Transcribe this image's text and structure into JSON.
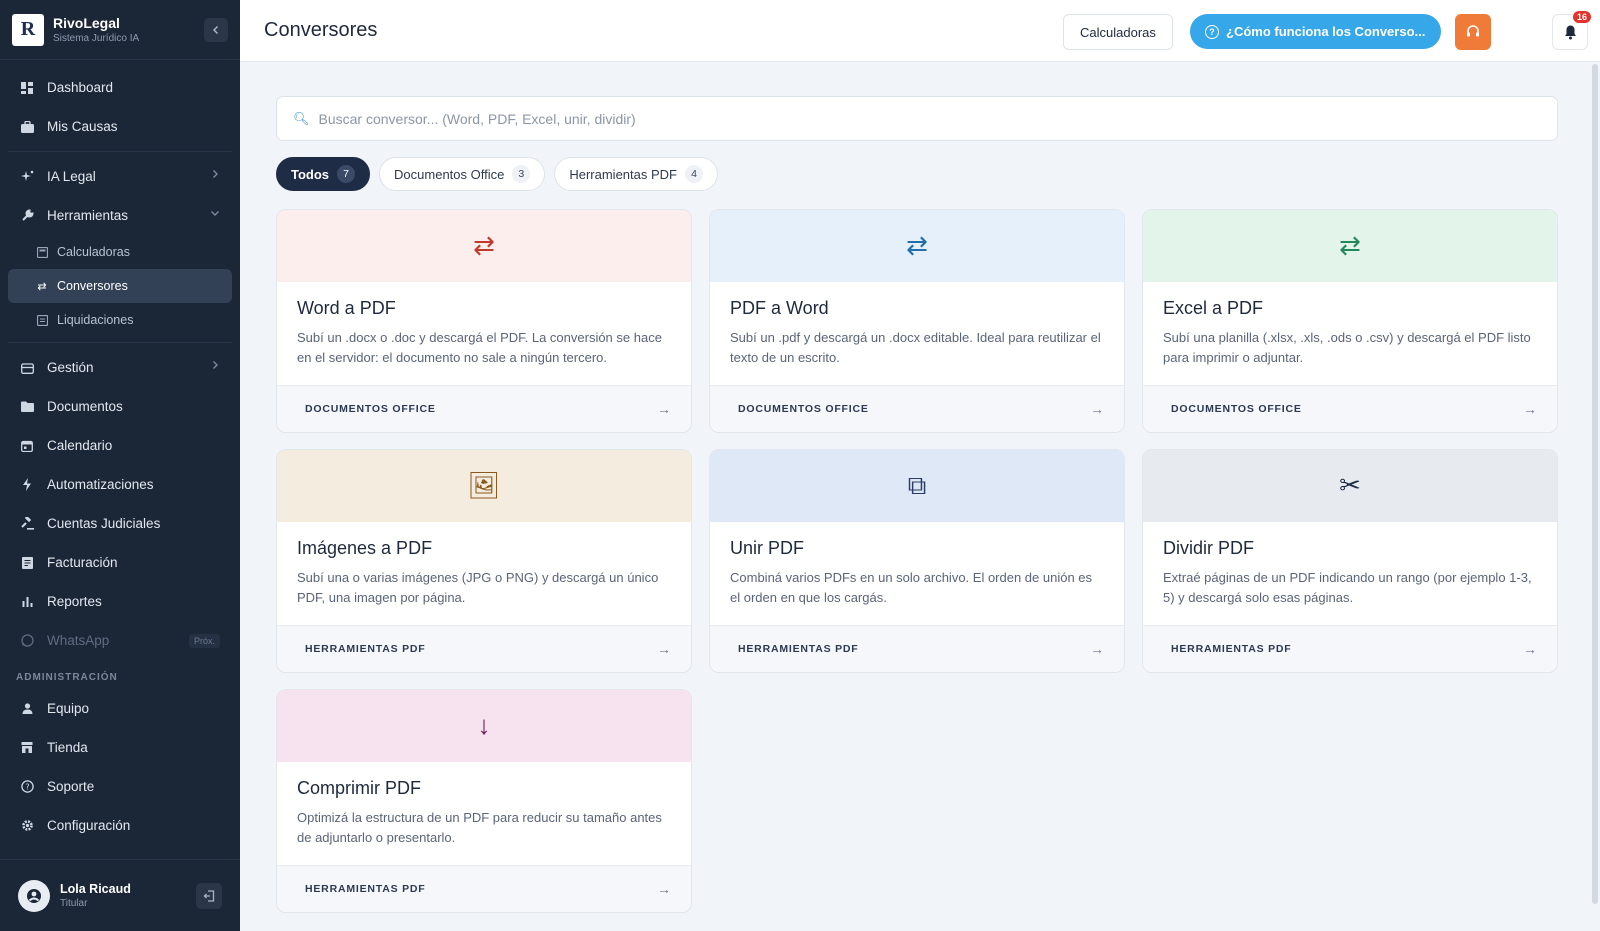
{
  "brand": {
    "name": "RivoLegal",
    "subtitle": "Sistema Jurídico IA",
    "logo_text": "R"
  },
  "sidebar": {
    "items": [
      {
        "label": "Dashboard",
        "icon": "dashboard-icon"
      },
      {
        "label": "Mis Causas",
        "icon": "briefcase-icon"
      },
      {
        "label": "IA Legal",
        "icon": "sparkle-icon"
      },
      {
        "label": "Herramientas",
        "icon": "wrench-icon"
      },
      {
        "label": "Gestión",
        "icon": "calendar-box-icon"
      },
      {
        "label": "Documentos",
        "icon": "folder-icon"
      },
      {
        "label": "Calendario",
        "icon": "calendar-icon"
      },
      {
        "label": "Automatizaciones",
        "icon": "bolt-icon"
      },
      {
        "label": "Cuentas Judiciales",
        "icon": "gavel-icon"
      },
      {
        "label": "Facturación",
        "icon": "invoice-icon"
      },
      {
        "label": "Reportes",
        "icon": "bar-chart-icon"
      },
      {
        "label": "WhatsApp",
        "icon": "whatsapp-icon",
        "badge": "Próx."
      }
    ],
    "subitems": [
      {
        "label": "Calculadoras"
      },
      {
        "label": "Conversores"
      },
      {
        "label": "Liquidaciones"
      }
    ],
    "admin_label": "ADMINISTRACIÓN",
    "admin_items": [
      {
        "label": "Equipo",
        "icon": "person-icon"
      },
      {
        "label": "Tienda",
        "icon": "store-icon"
      },
      {
        "label": "Soporte",
        "icon": "help-icon"
      },
      {
        "label": "Configuración",
        "icon": "gear-icon"
      }
    ]
  },
  "user": {
    "name": "Lola Ricaud",
    "role": "Titular"
  },
  "header": {
    "title": "Conversores",
    "calc_button": "Calculadoras",
    "help_button": "¿Cómo funciona los Converso...",
    "notifications": "16"
  },
  "search": {
    "placeholder": "Buscar conversor... (Word, PDF, Excel, unir, dividir)",
    "value": ""
  },
  "filters": [
    {
      "label": "Todos",
      "count": "7",
      "active": true
    },
    {
      "label": "Documentos Office",
      "count": "3",
      "active": false
    },
    {
      "label": "Herramientas PDF",
      "count": "4",
      "active": false
    }
  ],
  "cards": [
    {
      "title": "Word a PDF",
      "desc": "Subí un .docx o .doc y descargá el PDF. La conversión se hace en el servidor: el documento no sale a ningún tercero.",
      "category": "DOCUMENTOS OFFICE",
      "icon": "swap-icon",
      "glyph": "⇄",
      "bg": "#fbeeed",
      "color": "#c0392b"
    },
    {
      "title": "PDF a Word",
      "desc": "Subí un .pdf y descargá un .docx editable. Ideal para reutilizar el texto de un escrito.",
      "category": "DOCUMENTOS OFFICE",
      "icon": "swap-icon",
      "glyph": "⇄",
      "bg": "#e5f0fb",
      "color": "#1f6fa8"
    },
    {
      "title": "Excel a PDF",
      "desc": "Subí una planilla (.xlsx, .xls, .ods o .csv) y descargá el PDF listo para imprimir o adjuntar.",
      "category": "DOCUMENTOS OFFICE",
      "icon": "swap-icon",
      "glyph": "⇄",
      "bg": "#e3f5ea",
      "color": "#23895a"
    },
    {
      "title": "Imágenes a PDF",
      "desc": "Subí una o varias imágenes (JPG o PNG) y descargá un único PDF, una imagen por página.",
      "category": "HERRAMIENTAS PDF",
      "icon": "images-icon",
      "glyph": "🖼",
      "bg": "#f5ece0",
      "color": "#8a5a1c"
    },
    {
      "title": "Unir PDF",
      "desc": "Combiná varios PDFs en un solo archivo. El orden de unión es el orden en que los cargás.",
      "category": "HERRAMIENTAS PDF",
      "icon": "merge-icon",
      "glyph": "⧉",
      "bg": "#dfe8f6",
      "color": "#2a3d66"
    },
    {
      "title": "Dividir PDF",
      "desc": "Extraé páginas de un PDF indicando un rango (por ejemplo 1-3, 5) y descargá solo esas páginas.",
      "category": "HERRAMIENTAS PDF",
      "icon": "scissors-icon",
      "glyph": "✂",
      "bg": "#e7eaef",
      "color": "#1e2c46"
    },
    {
      "title": "Comprimir PDF",
      "desc": "Optimizá la estructura de un PDF para reducir su tamaño antes de adjuntarlo o presentarlo.",
      "category": "HERRAMIENTAS PDF",
      "icon": "arrow-down-icon",
      "glyph": "↓",
      "bg": "#f6e3ef",
      "color": "#6b1f55"
    }
  ],
  "card_arrow": "→"
}
